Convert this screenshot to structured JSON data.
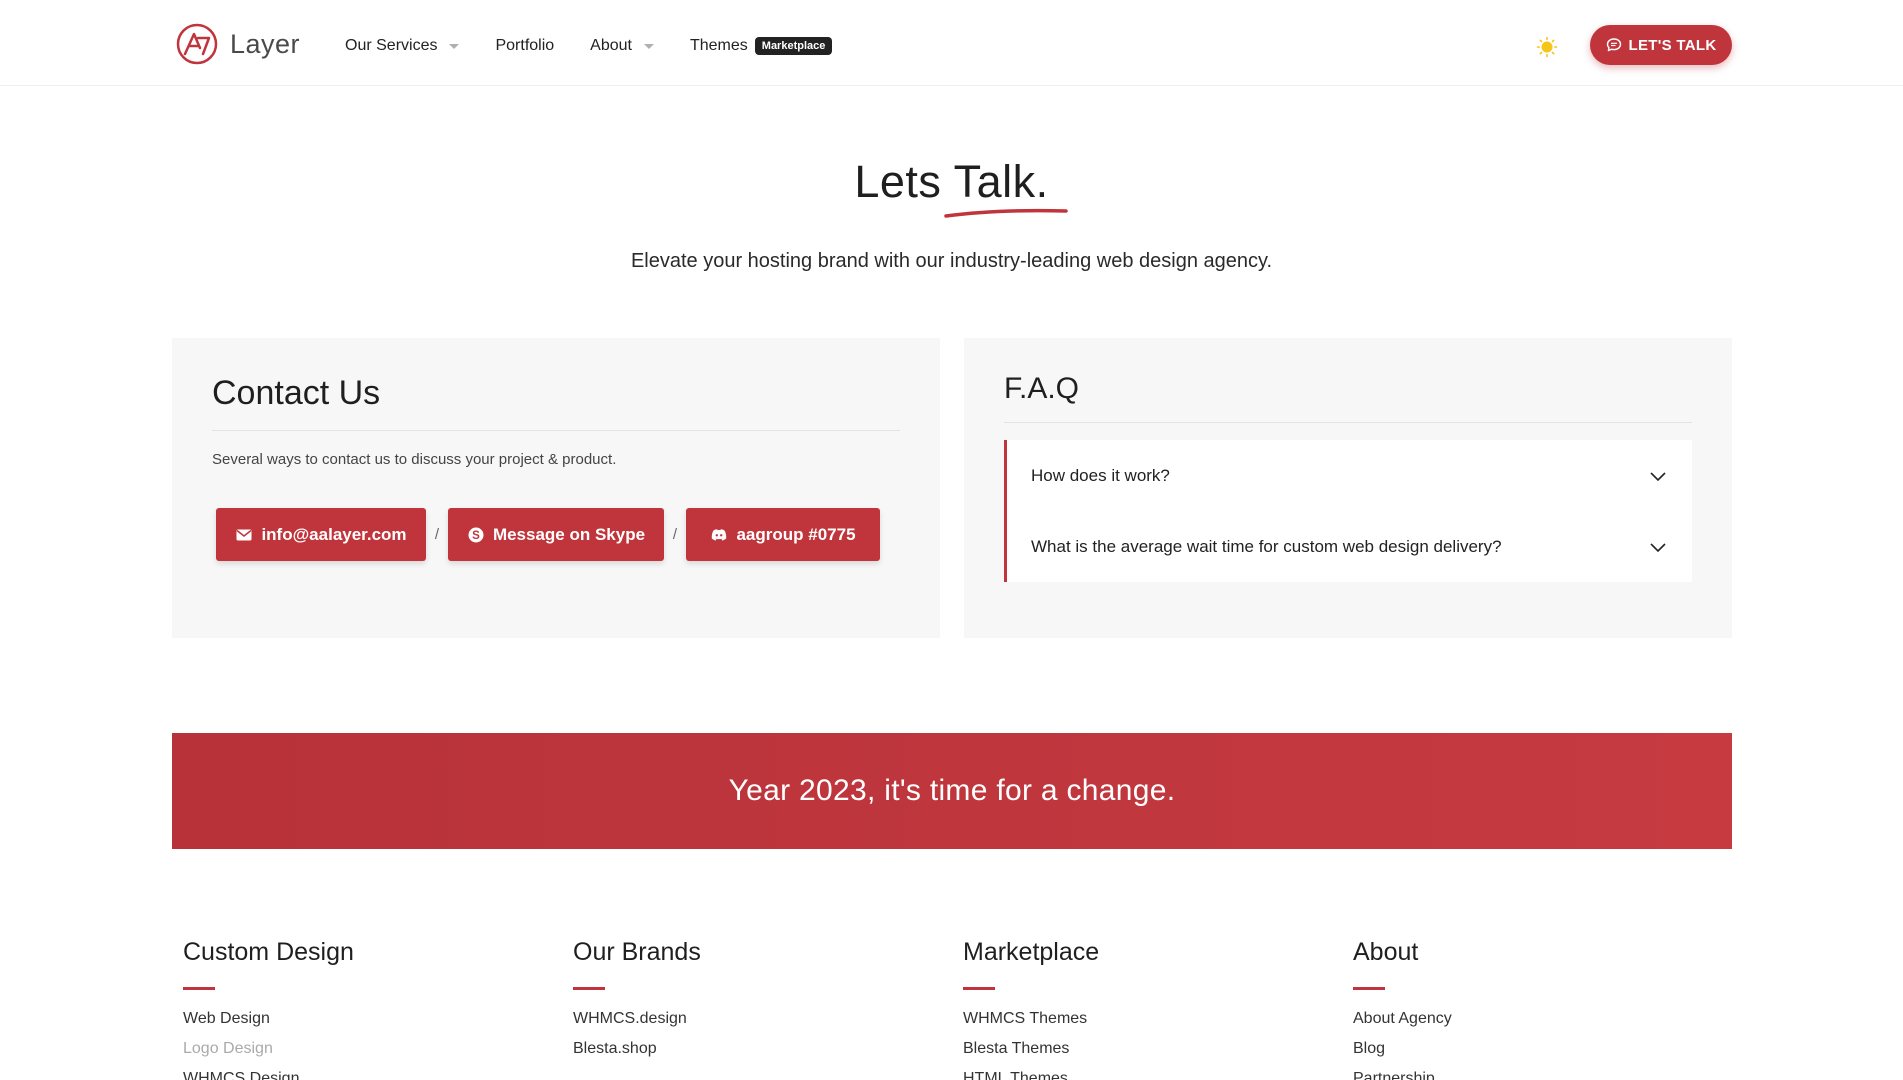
{
  "header": {
    "logo_text": "Layer",
    "nav": [
      {
        "label": "Our Services",
        "has_dropdown": true
      },
      {
        "label": "Portfolio",
        "has_dropdown": false
      },
      {
        "label": "About",
        "has_dropdown": true
      },
      {
        "label": "Themes",
        "badge": "Marketplace"
      }
    ],
    "theme_toggle_icon": "sun-icon",
    "cta_label": "LET'S TALK"
  },
  "hero": {
    "title": "Lets Talk.",
    "subtitle": "Elevate your hosting brand with our industry-leading web design agency."
  },
  "contact": {
    "title": "Contact Us",
    "description": "Several ways to contact us to discuss your project & product.",
    "buttons": [
      {
        "label": "info@aalayer.com",
        "icon": "mail-icon"
      },
      {
        "label": "Message on Skype",
        "icon": "skype-icon"
      },
      {
        "label": "aagroup #0775",
        "icon": "discord-icon"
      }
    ],
    "separator": "/"
  },
  "faq": {
    "title": "F.A.Q",
    "items": [
      {
        "question": "How does it work?"
      },
      {
        "question": "What is the average wait time for custom web design delivery?"
      }
    ]
  },
  "banner": {
    "text": "Year 2023, it's time for a change."
  },
  "footer": {
    "columns": [
      {
        "title": "Custom Design",
        "links": [
          "Web Design",
          "Logo Design",
          "WHMCS Design"
        ]
      },
      {
        "title": "Our Brands",
        "links": [
          "WHMCS.design",
          "Blesta.shop"
        ]
      },
      {
        "title": "Marketplace",
        "links": [
          "WHMCS Themes",
          "Blesta Themes",
          "HTML Themes"
        ]
      },
      {
        "title": "About",
        "links": [
          "About Agency",
          "Blog",
          "Partnership"
        ]
      }
    ]
  },
  "colors": {
    "accent": "#c0353b",
    "badge_bg": "#222222",
    "card_bg": "#f7f7f7",
    "sun": "#f5c518"
  }
}
